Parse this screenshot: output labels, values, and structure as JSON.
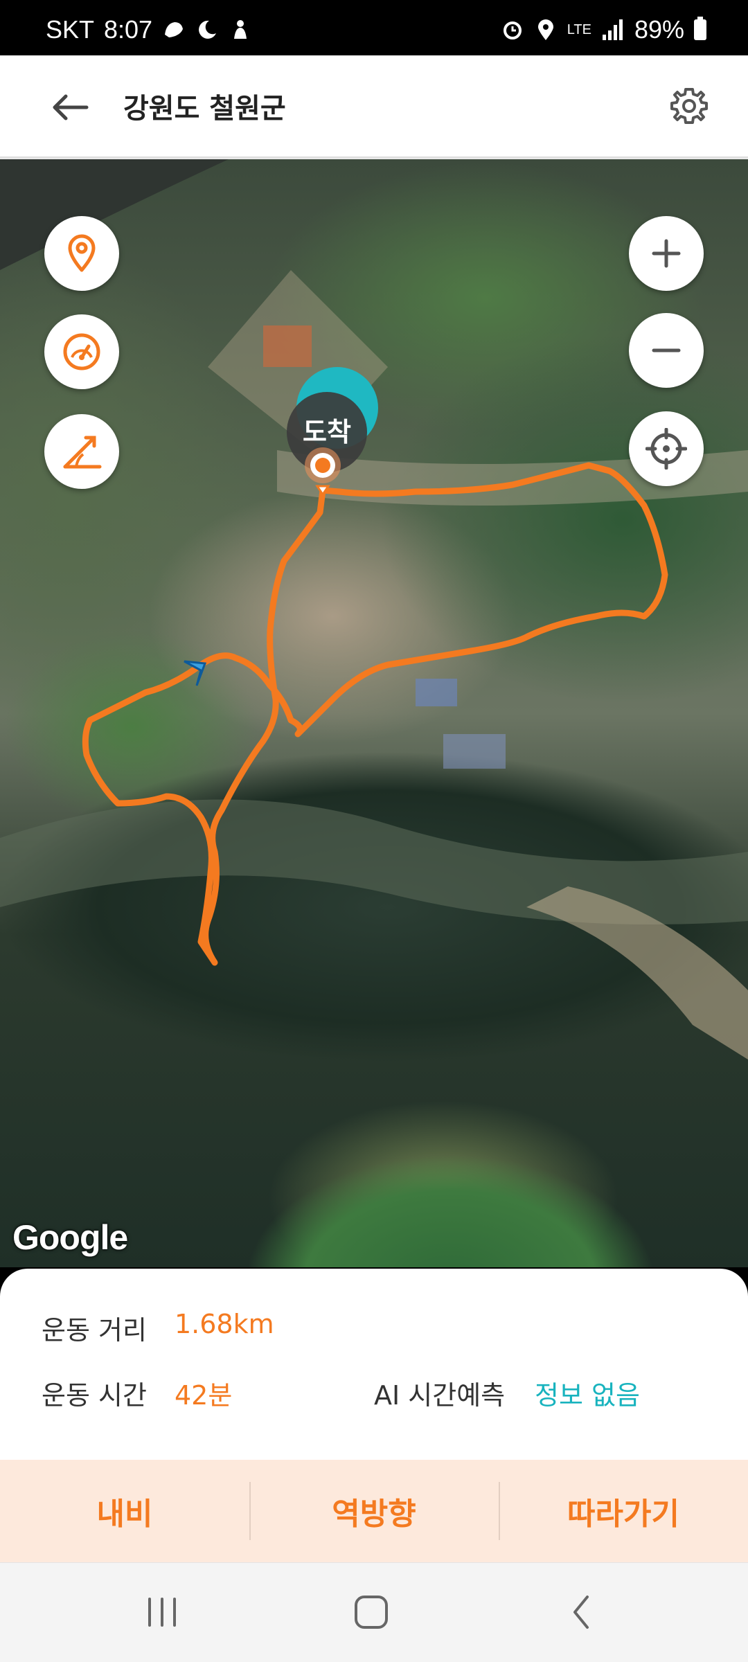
{
  "status_bar": {
    "carrier": "SKT",
    "time": "8:07",
    "network": "LTE",
    "battery": "89%",
    "icons_left": [
      "shoe-icon",
      "moon-icon",
      "person-icon"
    ],
    "icons_right": [
      "alarm-icon",
      "location-icon",
      "lte-icon",
      "signal-icon",
      "battery-icon"
    ]
  },
  "header": {
    "title": "강원도 철원군",
    "back_icon": "back-arrow-icon",
    "settings_icon": "gear-icon"
  },
  "map": {
    "left_controls": [
      "location-pin-icon",
      "speedometer-icon",
      "elevation-icon"
    ],
    "right_controls": [
      "zoom-in-icon",
      "zoom-out-icon",
      "my-location-icon"
    ],
    "arrival_label": "도착",
    "attribution": "Google",
    "route_color": "#f47a20"
  },
  "stats": {
    "distance_label": "운동 거리",
    "distance_value": "1.68km",
    "time_label": "운동 시간",
    "time_value": "42분",
    "ai_label": "AI 시간예측",
    "ai_value": "정보 없음"
  },
  "actions": {
    "navigate": "내비",
    "reverse": "역방향",
    "follow": "따라가기"
  },
  "colors": {
    "accent": "#f47a20",
    "teal": "#18b3be",
    "action_bg": "#fde9dc"
  }
}
